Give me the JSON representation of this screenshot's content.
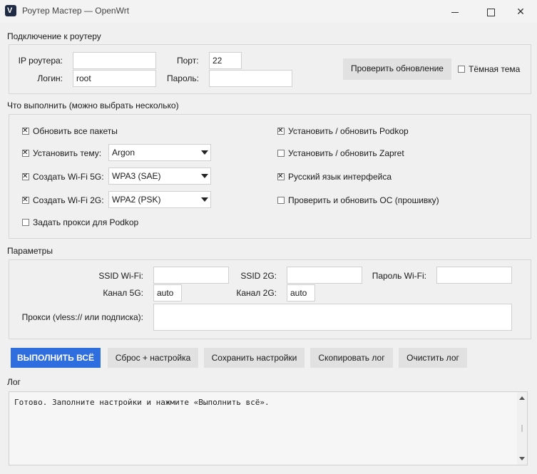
{
  "window": {
    "title": "Роутер Мастер — OpenWrt",
    "icon": "app-logo-icon",
    "min_glyph": "",
    "max_glyph": "",
    "close_glyph": "✕"
  },
  "connection": {
    "section_title": "Подключение к роутеру",
    "ip_label": "IP роутера:",
    "ip_value": "",
    "port_label": "Порт:",
    "port_value": "22",
    "login_label": "Логин:",
    "login_value": "root",
    "password_label": "Пароль:",
    "password_value": "",
    "check_update_label": "Проверить обновление",
    "dark_theme_label": "Тёмная тема",
    "dark_theme_checked": false
  },
  "tasks": {
    "section_title": "Что выполнить (можно выбрать несколько)",
    "update_packages": {
      "label": "Обновить все пакеты",
      "checked": true
    },
    "install_theme": {
      "label": "Установить тему:",
      "checked": true,
      "value": "Argon"
    },
    "wifi_5g": {
      "label": "Создать Wi-Fi 5G:",
      "checked": true,
      "value": "WPA3 (SAE)"
    },
    "wifi_2g": {
      "label": "Создать Wi-Fi 2G:",
      "checked": true,
      "value": "WPA2 (PSK)"
    },
    "proxy_podkop": {
      "label": "Задать прокси для Podkop",
      "checked": false
    },
    "install_podkop": {
      "label": "Установить / обновить Podkop",
      "checked": true
    },
    "install_zapret": {
      "label": "Установить / обновить Zapret",
      "checked": false
    },
    "russian_ui": {
      "label": "Русский язык интерфейса",
      "checked": true
    },
    "check_os": {
      "label": "Проверить и обновить ОС (прошивку)",
      "checked": false
    }
  },
  "params": {
    "section_title": "Параметры",
    "ssid_wifi_label": "SSID Wi-Fi:",
    "ssid_wifi_value": "",
    "ssid_2g_label": "SSID 2G:",
    "ssid_2g_value": "",
    "wifi_password_label": "Пароль Wi-Fi:",
    "wifi_password_value": "",
    "channel_5g_label": "Канал 5G:",
    "channel_5g_value": "auto",
    "channel_2g_label": "Канал 2G:",
    "channel_2g_value": "auto",
    "proxy_label": "Прокси (vless:// или подписка):",
    "proxy_value": ""
  },
  "actions": {
    "run_all": "ВЫПОЛНИТЬ ВСЁ",
    "reset_setup": "Сброс + настройка",
    "save_settings": "Сохранить настройки",
    "copy_log": "Скопировать лог",
    "clear_log": "Очистить лог"
  },
  "log": {
    "section_title": "Лог",
    "text": "Готово. Заполните настройки и нажмите «Выполнить всё»."
  },
  "colors": {
    "primary_button": "#2f6ede",
    "window_bg": "#f0f0f0"
  }
}
